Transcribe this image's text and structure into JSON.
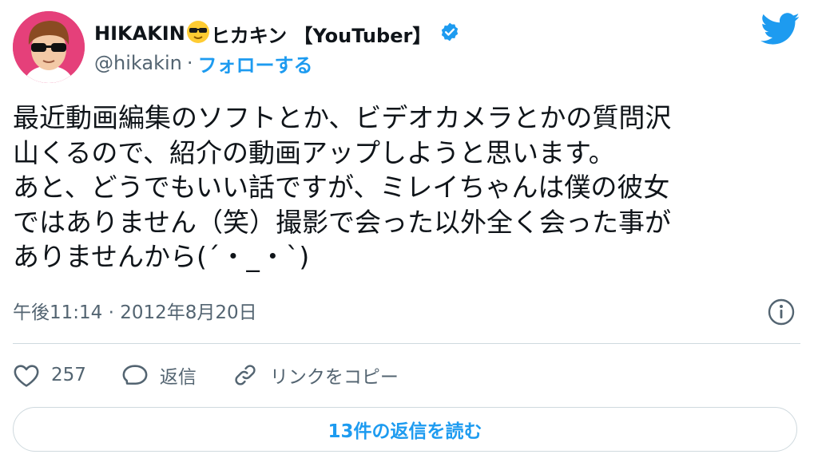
{
  "author": {
    "display_name": "HIKAKIN",
    "display_name_suffix": "ヒカキン 【YouTuber】",
    "name_emoji": "sunglasses-emoji",
    "handle": "@hikakin",
    "separator": "·",
    "follow_label": "フォローする",
    "verified": true,
    "avatar_color": "#e5407a"
  },
  "tweet": {
    "lines": [
      "最近動画編集のソフトとか、ビデオカメラとかの質問沢",
      "山くるので、紹介の動画アップしようと思います。",
      "あと、どうでもいい話ですが、ミレイちゃんは僕の彼女",
      "ではありません（笑）撮影で会った以外全く会った事が",
      "ありませんから(´・_・`)"
    ],
    "timestamp": "午後11:14 · 2012年8月20日"
  },
  "actions": {
    "like_count": "257",
    "reply_label": "返信",
    "copy_link_label": "リンクをコピー"
  },
  "replies_button_label": "13件の返信を読む",
  "colors": {
    "accent": "#1d9bf0",
    "text": "#0f1419",
    "secondary": "#536471",
    "border": "#cfd9de"
  }
}
